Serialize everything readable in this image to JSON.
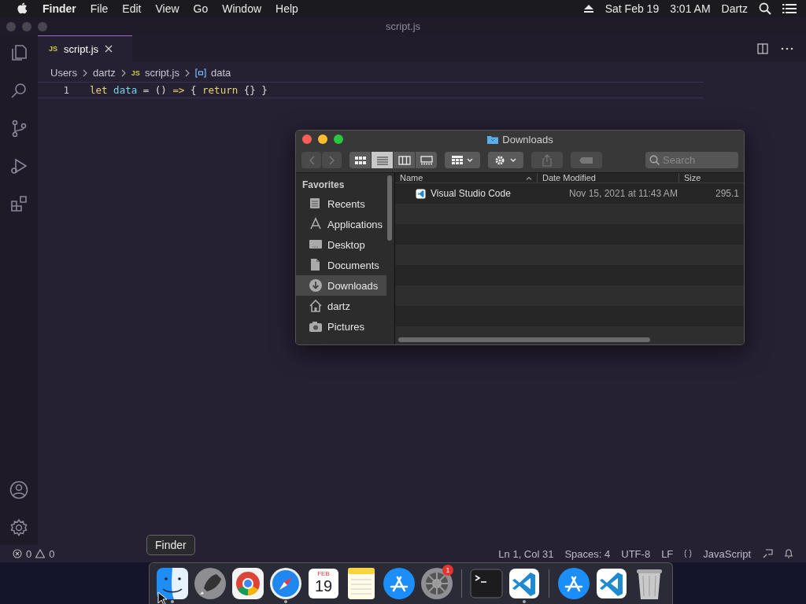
{
  "menubar": {
    "app": "Finder",
    "menus": [
      "File",
      "Edit",
      "View",
      "Go",
      "Window",
      "Help"
    ],
    "date": "Sat Feb 19",
    "time": "3:01 AM",
    "user": "Dartz"
  },
  "editor": {
    "title": "script.js",
    "tabs": [
      {
        "badge": "JS",
        "label": "script.js",
        "selected": true
      }
    ],
    "breadcrumbs": [
      {
        "kind": "folder",
        "label": "Users"
      },
      {
        "kind": "folder",
        "label": "dartz"
      },
      {
        "kind": "file",
        "badge": "JS",
        "label": "script.js"
      },
      {
        "kind": "symbol",
        "label": "data"
      }
    ],
    "lines": [
      {
        "number": "1",
        "tokens": [
          {
            "kind": "keyword",
            "text": "let"
          },
          {
            "kind": "variable",
            "text": "data"
          },
          {
            "kind": "plain",
            "text": "="
          },
          {
            "kind": "plain",
            "text": "()"
          },
          {
            "kind": "keyword",
            "text": "=>"
          },
          {
            "kind": "plain",
            "text": "{"
          },
          {
            "kind": "keyword",
            "text": "return"
          },
          {
            "kind": "plain",
            "text": "{}"
          },
          {
            "kind": "plain",
            "text": "}"
          }
        ]
      }
    ],
    "status": {
      "errors": "0",
      "warnings": "0",
      "items": [
        "Ln 1, Col 31",
        "Spaces: 4",
        "UTF-8",
        "LF",
        "JavaScript"
      ]
    }
  },
  "finder": {
    "title": "Downloads",
    "views": [
      {
        "kind": "icons",
        "selected": false
      },
      {
        "kind": "list",
        "selected": true
      },
      {
        "kind": "columns",
        "selected": false
      },
      {
        "kind": "gallery",
        "selected": false
      }
    ],
    "search": {
      "placeholder": "Search"
    },
    "sidebar": {
      "heading": "Favorites",
      "items": [
        {
          "kind": "recents",
          "label": "Recents",
          "selected": false
        },
        {
          "kind": "applications",
          "label": "Applications",
          "selected": false
        },
        {
          "kind": "desktop",
          "label": "Desktop",
          "selected": false
        },
        {
          "kind": "documents",
          "label": "Documents",
          "selected": false
        },
        {
          "kind": "downloads",
          "label": "Downloads",
          "selected": true
        },
        {
          "kind": "home",
          "label": "dartz",
          "selected": false
        },
        {
          "kind": "pictures",
          "label": "Pictures",
          "selected": false
        }
      ]
    },
    "columns": [
      "Name",
      "Date Modified",
      "Size"
    ],
    "rows": [
      {
        "name": "Visual Studio Code",
        "date": "Nov 15, 2021 at 11:43 AM",
        "size": "295.1"
      }
    ]
  },
  "dock": {
    "tooltip": "Finder",
    "groups": [
      [
        {
          "kind": "finder",
          "running": true
        },
        {
          "kind": "launchpad",
          "running": false
        },
        {
          "kind": "chrome",
          "running": false
        },
        {
          "kind": "safari",
          "running": true
        },
        {
          "kind": "calendar",
          "month": "FEB",
          "day": "19",
          "running": false
        },
        {
          "kind": "notes",
          "running": false
        },
        {
          "kind": "appstore",
          "running": false
        },
        {
          "kind": "settings",
          "badge": "1",
          "running": false
        }
      ],
      [
        {
          "kind": "terminal",
          "running": false
        },
        {
          "kind": "vscode",
          "running": true
        }
      ],
      [
        {
          "kind": "appstore",
          "running": false
        },
        {
          "kind": "vscode",
          "running": false
        },
        {
          "kind": "trash",
          "running": false
        }
      ]
    ]
  }
}
